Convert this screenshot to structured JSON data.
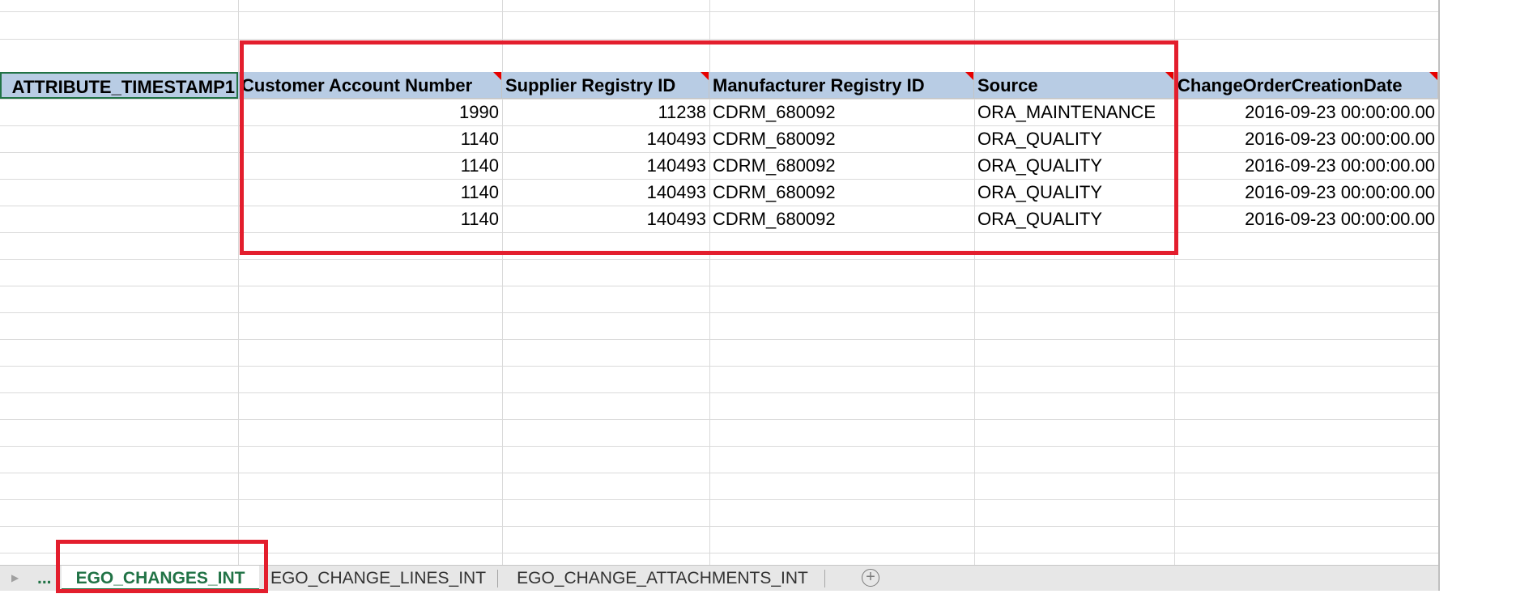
{
  "sheet": {
    "headers": [
      "ATTRIBUTE_TIMESTAMP1",
      "Customer Account Number",
      "Supplier Registry ID",
      "Manufacturer Registry ID",
      "Source",
      "ChangeOrderCreationDate"
    ],
    "rows": [
      [
        "1990",
        "11238",
        "CDRM_680092",
        "ORA_MAINTENANCE",
        "2016-09-23 00:00:00.00"
      ],
      [
        "1140",
        "140493",
        "CDRM_680092",
        "ORA_QUALITY",
        "2016-09-23 00:00:00.00"
      ],
      [
        "1140",
        "140493",
        "CDRM_680092",
        "ORA_QUALITY",
        "2016-09-23 00:00:00.00"
      ],
      [
        "1140",
        "140493",
        "CDRM_680092",
        "ORA_QUALITY",
        "2016-09-23 00:00:00.00"
      ],
      [
        "1140",
        "140493",
        "CDRM_680092",
        "ORA_QUALITY",
        "2016-09-23 00:00:00.00"
      ]
    ]
  },
  "tabs": {
    "scroll_left_icon": "triangle-right-icon",
    "overflow": "...",
    "items": [
      "EGO_CHANGES_INT",
      "EGO_CHANGE_LINES_INT",
      "EGO_CHANGE_ATTACHMENTS_INT"
    ],
    "active_index": 0,
    "add_icon": "plus-circle-icon",
    "add_symbol": "+"
  },
  "colors": {
    "header_fill": "#b8cce4",
    "highlight_red": "#e31e2d",
    "excel_green": "#217346"
  }
}
